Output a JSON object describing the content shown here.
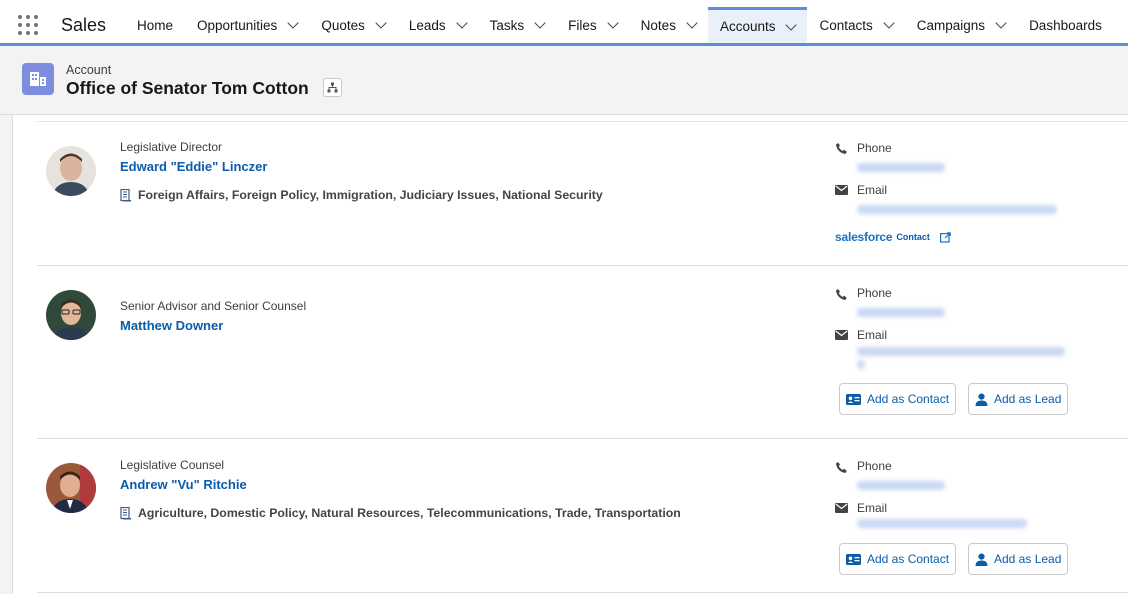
{
  "app": {
    "name": "Sales"
  },
  "nav": {
    "tabs": [
      {
        "label": "Home",
        "dropdown": false
      },
      {
        "label": "Opportunities",
        "dropdown": true
      },
      {
        "label": "Quotes",
        "dropdown": true
      },
      {
        "label": "Leads",
        "dropdown": true
      },
      {
        "label": "Tasks",
        "dropdown": true
      },
      {
        "label": "Files",
        "dropdown": true
      },
      {
        "label": "Notes",
        "dropdown": true
      },
      {
        "label": "Accounts",
        "dropdown": true,
        "active": true
      },
      {
        "label": "Contacts",
        "dropdown": true
      },
      {
        "label": "Campaigns",
        "dropdown": true
      },
      {
        "label": "Dashboards",
        "dropdown": false
      }
    ]
  },
  "header": {
    "object_label": "Account",
    "record_name": "Office of Senator Tom Cotton"
  },
  "contact_labels": {
    "phone": "Phone",
    "email": "Email"
  },
  "people": [
    {
      "title": "Legislative Director",
      "name": "Edward \"Eddie\" Linczer",
      "issues": "Foreign Affairs, Foreign Policy, Immigration, Judiciary Issues, National Security",
      "salesforce_brand": "salesforce",
      "salesforce_link": "Contact"
    },
    {
      "title": "Senior Advisor and Senior Counsel",
      "name": "Matthew Downer",
      "issues": "",
      "add_contact": "Add as Contact",
      "add_lead": "Add as Lead"
    },
    {
      "title": "Legislative Counsel",
      "name": "Andrew \"Vu\" Ritchie",
      "issues": "Agriculture, Domestic Policy, Natural Resources, Telecommunications, Trade, Transportation",
      "add_contact": "Add as Contact",
      "add_lead": "Add as Lead"
    }
  ],
  "colors": {
    "accent": "#0b5cab",
    "nav_underline": "#5b8ed6",
    "account_icon": "#7f8de1"
  }
}
